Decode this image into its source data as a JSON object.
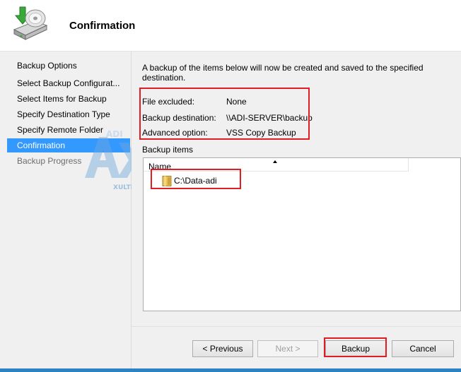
{
  "header": {
    "title": "Confirmation",
    "icon": "backup-disk-icon"
  },
  "sidebar": {
    "items": [
      {
        "label": "Backup Options",
        "state": "normal"
      },
      {
        "label": "Select Backup Configurat...",
        "state": "normal"
      },
      {
        "label": "Select Items for Backup",
        "state": "normal"
      },
      {
        "label": "Specify Destination Type",
        "state": "normal"
      },
      {
        "label": "Specify Remote Folder",
        "state": "normal"
      },
      {
        "label": "Confirmation",
        "state": "active"
      },
      {
        "label": "Backup Progress",
        "state": "disabled"
      }
    ]
  },
  "main": {
    "intro": "A backup of the items below will now be created and saved to the specified destination.",
    "summary": [
      {
        "key": "File excluded:",
        "value": "None"
      },
      {
        "key": "Backup destination:",
        "value": "\\\\ADI-SERVER\\backup"
      },
      {
        "key": "Advanced option:",
        "value": "VSS Copy Backup"
      }
    ],
    "items_label": "Backup items",
    "list": {
      "column_header": "Name",
      "rows": [
        {
          "name": "C:\\Data-adi",
          "icon": "folder-icon"
        }
      ]
    }
  },
  "footer": {
    "previous_label": "< Previous",
    "next_label": "Next >",
    "backup_label": "Backup",
    "cancel_label": "Cancel"
  },
  "watermark": {
    "text": "ADI",
    "subtext": "XULTIMATE"
  },
  "colors": {
    "accent": "#3399ff",
    "highlight_box": "#e31c23",
    "panel": "#f0f0f0",
    "bottom_bar": "#2a83c7"
  }
}
